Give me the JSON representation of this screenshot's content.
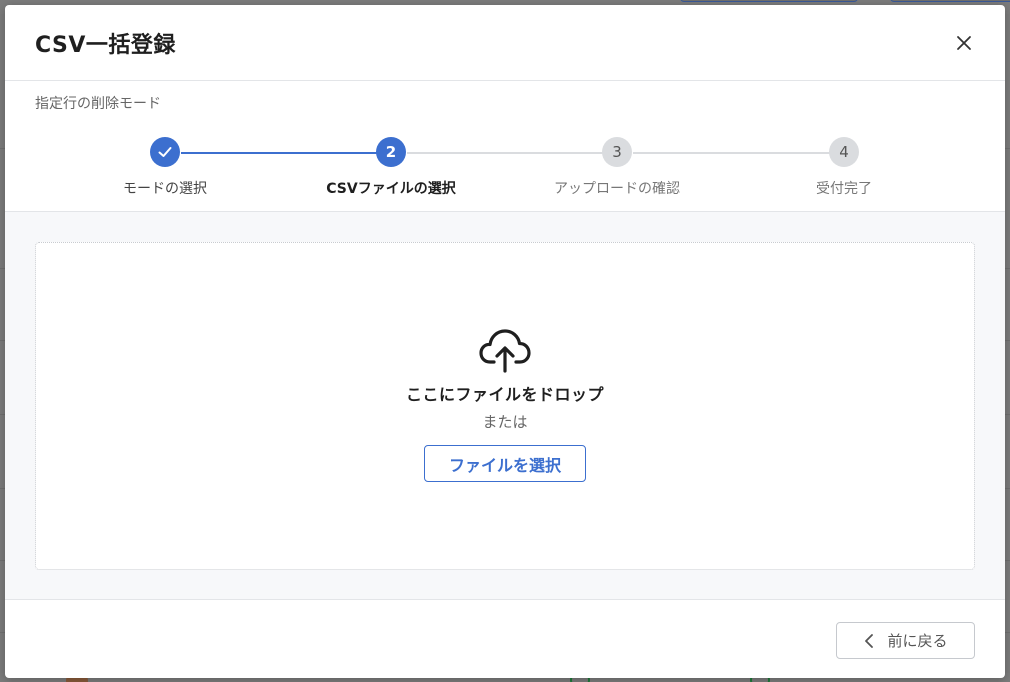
{
  "modal": {
    "title": "CSV一括登録",
    "subheader": "指定行の削除モード"
  },
  "stepper": {
    "steps": [
      {
        "number": "1",
        "label": "モードの選択",
        "state": "done"
      },
      {
        "number": "2",
        "label": "CSVファイルの選択",
        "state": "active"
      },
      {
        "number": "3",
        "label": "アップロードの確認",
        "state": "pending"
      },
      {
        "number": "4",
        "label": "受付完了",
        "state": "pending"
      }
    ]
  },
  "dropzone": {
    "icon": "cloud-upload-icon",
    "title": "ここにファイルをドロップ",
    "or_text": "または",
    "select_button_label": "ファイルを選択"
  },
  "footer": {
    "back_button_label": "前に戻る"
  },
  "colors": {
    "accent": "#3c6fcf",
    "pending": "#dadcdf",
    "overlay": "#7c7c7c"
  }
}
